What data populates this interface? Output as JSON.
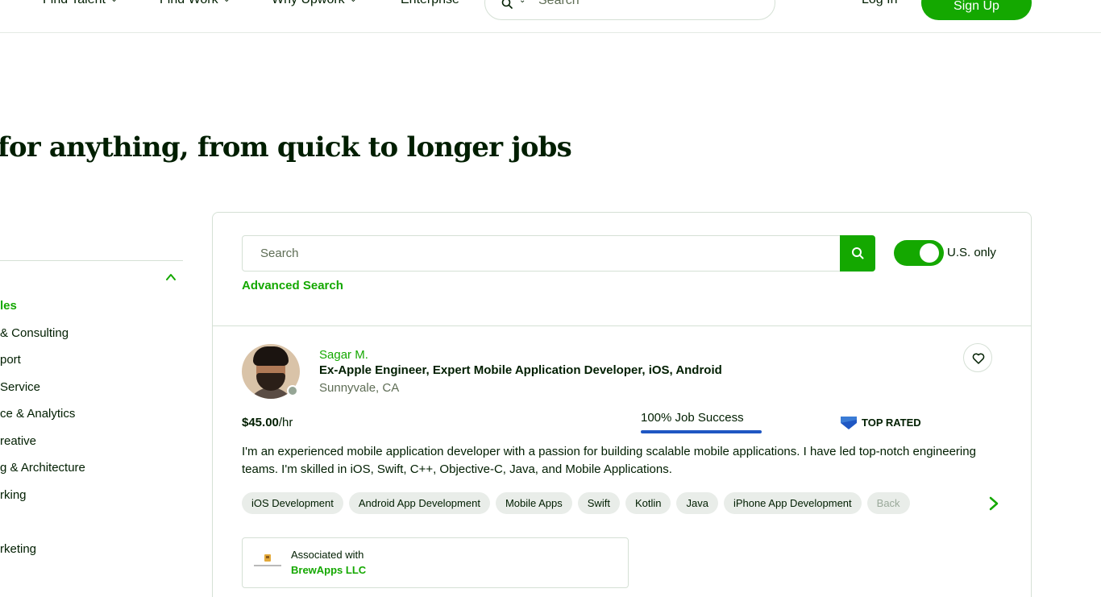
{
  "nav": {
    "find_talent": "Find Talent",
    "find_work": "Find Work",
    "why_upwork": "Why Upwork",
    "enterprise": "Enterprise",
    "search_placeholder": "Search",
    "login": "Log In",
    "signup": "Sign Up"
  },
  "headline": "for anything, from quick to longer jobs",
  "sidebar": {
    "items": [
      {
        "label": "les",
        "active": true
      },
      {
        "label": " & Consulting",
        "active": false
      },
      {
        "label": "port",
        "active": false
      },
      {
        "label": "Service",
        "active": false
      },
      {
        "label": "ce & Analytics",
        "active": false
      },
      {
        "label": "reative",
        "active": false
      },
      {
        "label": "g & Architecture",
        "active": false
      },
      {
        "label": "rking",
        "active": false
      },
      {
        "label": "rketing",
        "active": false
      }
    ]
  },
  "search": {
    "placeholder": "Search",
    "toggle_label": "U.S. only",
    "toggle_on": true,
    "advanced": "Advanced Search"
  },
  "freelancer": {
    "name": "Sagar M.",
    "title": "Ex-Apple Engineer, Expert Mobile Application Developer, iOS, Android",
    "location": "Sunnyvale, CA",
    "rate_value": "$45.00",
    "rate_unit": "/hr",
    "job_success": "100% Job Success",
    "badge": "TOP RATED",
    "description": "I'm an experienced mobile application developer with a passion for building scalable mobile applications. I have led top-notch engineering teams. I'm skilled in iOS, Swift, C++, Objective-C, Java, and Mobile Applications.",
    "skills": [
      "iOS Development",
      "Android App Development",
      "Mobile Apps",
      "Swift",
      "Kotlin",
      "Java",
      "iPhone App Development",
      "Back"
    ],
    "assoc_label": "Associated with",
    "assoc_company": "BrewApps LLC"
  },
  "colors": {
    "brand_green": "#14a800",
    "text": "#001e00",
    "muted": "#5e6d55",
    "border": "#d5e0d5",
    "jss_blue": "#1f57c3"
  }
}
